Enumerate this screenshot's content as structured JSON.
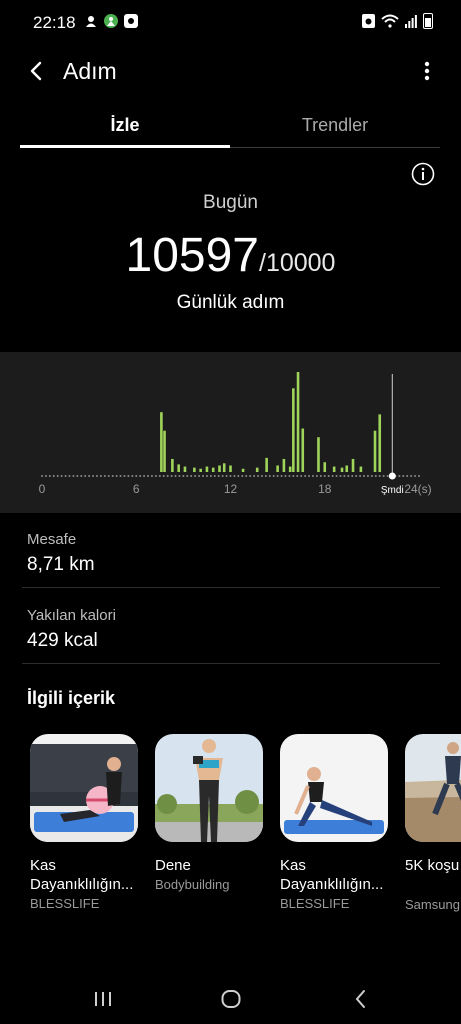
{
  "status_bar": {
    "time": "22:18"
  },
  "app_bar": {
    "title": "Adım"
  },
  "tabs": [
    {
      "label": "İzle",
      "active": true
    },
    {
      "label": "Trendler",
      "active": false
    }
  ],
  "summary": {
    "day_label": "Bugün",
    "steps": "10597",
    "goal": "/10000",
    "caption": "Günlük adım"
  },
  "chart_data": {
    "type": "bar",
    "x_ticks": [
      "0",
      "6",
      "12",
      "18",
      "Şmdi",
      "24(s)"
    ],
    "bar_color": "#9fd45a",
    "bars": [
      {
        "hour": 7.6,
        "value": 55
      },
      {
        "hour": 7.8,
        "value": 38
      },
      {
        "hour": 8.3,
        "value": 12
      },
      {
        "hour": 8.7,
        "value": 7
      },
      {
        "hour": 9.1,
        "value": 5
      },
      {
        "hour": 9.7,
        "value": 4
      },
      {
        "hour": 10.1,
        "value": 3
      },
      {
        "hour": 10.5,
        "value": 5
      },
      {
        "hour": 10.9,
        "value": 4
      },
      {
        "hour": 11.3,
        "value": 6
      },
      {
        "hour": 11.6,
        "value": 8
      },
      {
        "hour": 12.0,
        "value": 6
      },
      {
        "hour": 12.8,
        "value": 3
      },
      {
        "hour": 13.7,
        "value": 4
      },
      {
        "hour": 14.3,
        "value": 13
      },
      {
        "hour": 15.0,
        "value": 6
      },
      {
        "hour": 15.4,
        "value": 12
      },
      {
        "hour": 15.8,
        "value": 5
      },
      {
        "hour": 16.0,
        "value": 77
      },
      {
        "hour": 16.3,
        "value": 92
      },
      {
        "hour": 16.6,
        "value": 40
      },
      {
        "hour": 17.6,
        "value": 32
      },
      {
        "hour": 18.0,
        "value": 9
      },
      {
        "hour": 18.6,
        "value": 5
      },
      {
        "hour": 19.1,
        "value": 4
      },
      {
        "hour": 19.4,
        "value": 6
      },
      {
        "hour": 19.8,
        "value": 12
      },
      {
        "hour": 20.3,
        "value": 5
      },
      {
        "hour": 21.2,
        "value": 38
      },
      {
        "hour": 21.5,
        "value": 53
      }
    ],
    "now_hour": 22.3,
    "xlim": [
      0,
      24
    ]
  },
  "stats": [
    {
      "label": "Mesafe",
      "value": "8,71 km"
    },
    {
      "label": "Yakılan kalori",
      "value": "429 kcal"
    }
  ],
  "related": {
    "title": "İlgili içerik",
    "cards": [
      {
        "title1": "Kas",
        "title2": "Dayanıklılığın...",
        "source": "BLESSLIFE"
      },
      {
        "title1": "Dene",
        "title2": "",
        "source": "Bodybuilding"
      },
      {
        "title1": "Kas",
        "title2": "Dayanıklılığın...",
        "source": "BLESSLIFE"
      },
      {
        "title1": "5K koşu",
        "title2": "",
        "source": "Samsung"
      }
    ]
  }
}
